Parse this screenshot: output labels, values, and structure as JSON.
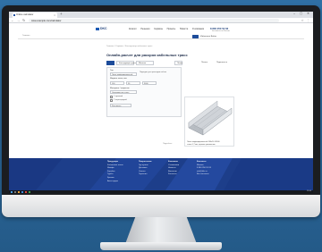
{
  "browser": {
    "tab_title": "Online calculator",
    "url": "www.example.com/calculator",
    "new_tab": "+",
    "tab_close": "×",
    "window_controls": "– ▢ ✕",
    "nav": "← → ↻",
    "extensions": "☆ ⋮"
  },
  "header": {
    "logo": "DKC",
    "nav": [
      "Каталог",
      "Решения",
      "Сервисы",
      "Проекты",
      "Новости",
      "О компании"
    ],
    "phone": "8 800 250 52 63",
    "phone_sub": "бесплатно по России",
    "subnav_left": "Главная",
    "subnav_right": "Избранное   Войти"
  },
  "breadcrumb": "Главная / Сервисы / Калькулятор кабельных трасс",
  "page_title": "Онлайн-расчет для раскроя кабельных трасс",
  "calc_tabs": [
    "Лотки",
    "Конструкция трассы",
    "Монтаж"
  ],
  "actions": {
    "print": "Печать",
    "share": "Поделиться"
  },
  "form": {
    "field1_label": "Тип",
    "field1_value": "Лоток перфорированный",
    "field1_hint": "Подходит для прокладки кабеля",
    "field2_label": "Ширина лотка, мм",
    "field2_value": "100",
    "field3_value": "50",
    "field4_value": "3000",
    "field5_label": "Материал / покрытие",
    "field5_value": "Оцинкованная сталь",
    "check1": "С крышкой",
    "check2": "С перегородкой",
    "button": "Рассчитать"
  },
  "product": {
    "caption_line1": "Лоток перфорированный 100х50 L3000",
    "caption_line2": "сталь 0,7 мм, горячее цинкование"
  },
  "small_link": "Подробнее",
  "footer": {
    "columns": [
      {
        "head": "Продукция",
        "items": [
          "Кабельные лотки",
          "Шкафы",
          "Коробки",
          "Трубы",
          "Крепеж",
          "Аксессуары"
        ]
      },
      {
        "head": "Покупателям",
        "items": [
          "Где купить",
          "Доставка",
          "Оплата",
          "Гарантия"
        ]
      },
      {
        "head": "Компания",
        "items": [
          "О компании",
          "Новости",
          "Вакансии",
          "Контакты"
        ]
      },
      {
        "head": "Контакты",
        "items": [
          "Москва",
          "8 800 250 52 63",
          "info@dkc.ru",
          "Все контакты"
        ]
      }
    ]
  },
  "taskbar": {
    "time": "12:00"
  },
  "colors": {
    "accent": "#1d4c9a",
    "footer": "#1d3e8a",
    "background": "#2a6697"
  }
}
